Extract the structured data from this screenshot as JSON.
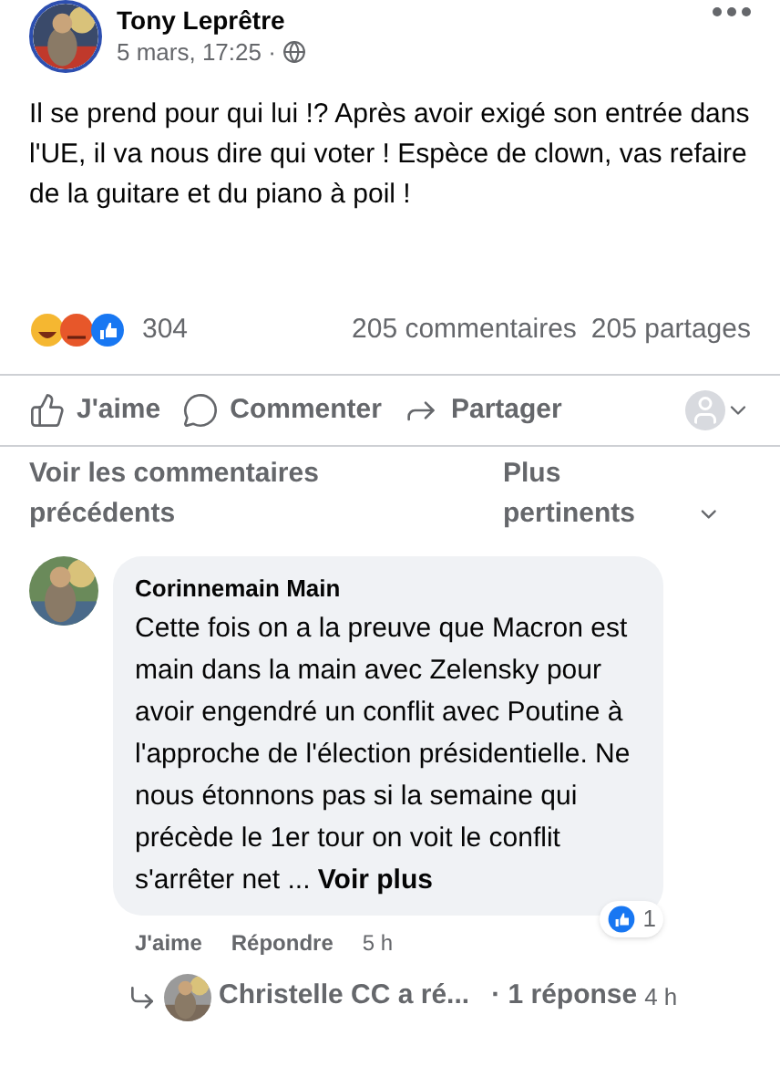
{
  "post": {
    "author": "Tony Leprêtre",
    "time": "5 mars, 17:25 ·",
    "text": "Il se prend pour qui lui !? Après avoir exigé son entrée dans l'UE, il va nous dire qui voter ! Espèce de clown, vas refaire de la guitare et du piano à poil !"
  },
  "stats": {
    "reactions": "304",
    "comments": "205 commentaires",
    "shares": "205 partages"
  },
  "actions": [
    {
      "kind": "like",
      "label": "J'aime"
    },
    {
      "kind": "comment",
      "label": "Commenter"
    },
    {
      "kind": "share",
      "label": "Partager"
    }
  ],
  "comments_bar": {
    "previous": "Voir les commentaires précédents",
    "sort": "Plus pertinents"
  },
  "comment": {
    "author": "Corinnemain Main",
    "text": "Cette fois on a la preuve que Macron est main dans la main avec Zelensky pour avoir engendré un conflit avec Poutine à l'approche de l'élection présidentielle. Ne nous étonnons pas si la semaine qui précède le 1er tour on voit le conflit s'arrêter net ...",
    "more": "Voir plus",
    "likes": "1",
    "like": "J'aime",
    "reply": "Répondre",
    "time": "5 h"
  },
  "reply_preview": {
    "text": "Christelle CC a ré...",
    "count": "· 1 réponse",
    "time": "4 h"
  }
}
